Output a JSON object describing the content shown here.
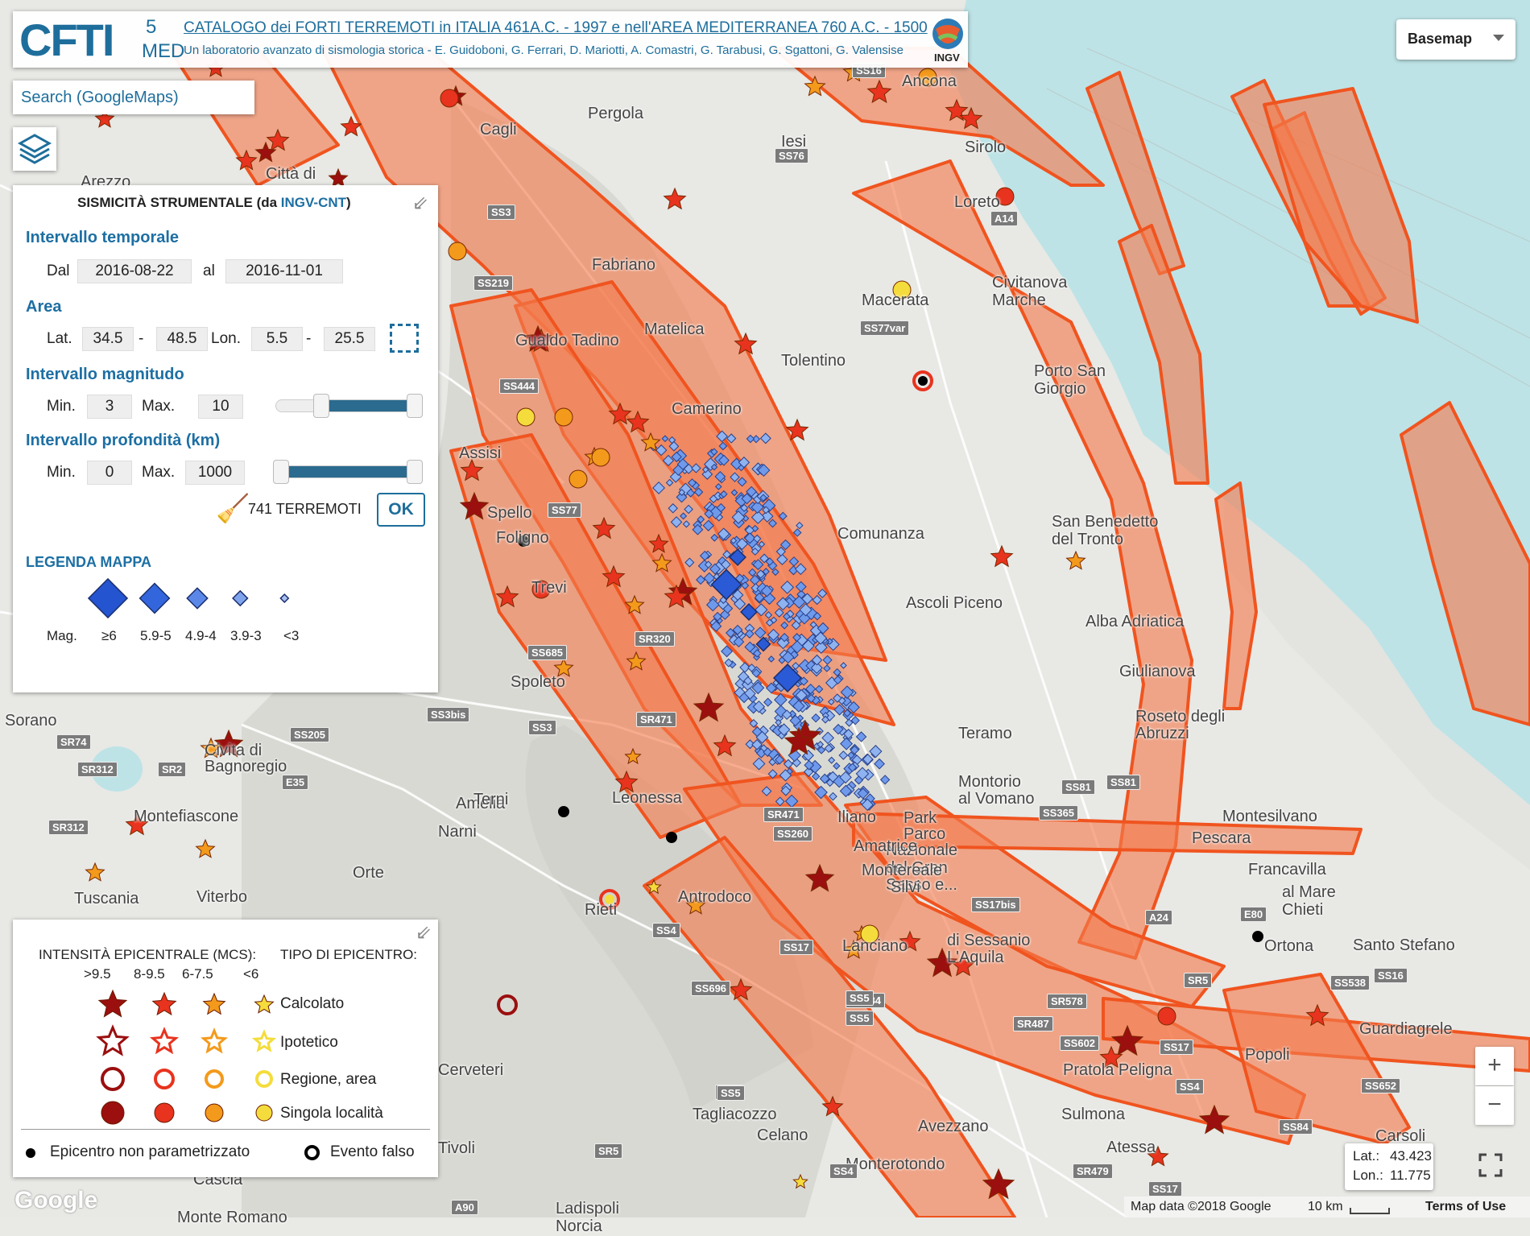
{
  "header": {
    "logo_main": "CFTI",
    "logo_super": "5",
    "logo_sub": "MED",
    "title": "CATALOGO dei FORTI TERREMOTI in ITALIA 461A.C. - 1997 e nell'AREA MEDITERRANEA 760 A.C. - 1500",
    "subtitle": "Un laboratorio avanzato di sismologia storica - E. Guidoboni, G. Ferrari, D. Mariotti, A. Comastri, G. Tarabusi, G. Sgattoni, G. Valensise",
    "ingv_label": "INGV"
  },
  "search": {
    "placeholder": "Search (GoogleMaps)"
  },
  "basemap": {
    "label": "Basemap"
  },
  "filter_panel": {
    "title_prefix": "SISMICITÀ STRUMENTALE (da ",
    "title_link": "INGV-CNT",
    "title_suffix": ")",
    "time_heading": "Intervallo temporale",
    "from_label": "Dal",
    "from_value": "2016-08-22",
    "to_label": "al",
    "to_value": "2016-11-01",
    "area_heading": "Area",
    "lat_label": "Lat.",
    "lat_min": "34.5",
    "lat_max": "48.5",
    "lon_label": "Lon.",
    "lon_min": "5.5",
    "lon_max": "25.5",
    "dash": "-",
    "mag_heading": "Intervallo magnitudo",
    "min_label": "Min.",
    "max_label": "Max.",
    "mag_min": "3",
    "mag_max": "10",
    "depth_heading": "Intervallo profondità (km)",
    "depth_min": "0",
    "depth_max": "1000",
    "count_text": "741 TERREMOTI",
    "ok_label": "OK",
    "legend_heading": "LEGENDA MAPPA",
    "legend_mag_label": "Mag.",
    "legend_classes": [
      "≥6",
      "5.9-5",
      "4.9-4",
      "3.9-3",
      "<3"
    ]
  },
  "legend_panel": {
    "intensity_heading": "INTENSITÀ EPICENTRALE (MCS):",
    "type_heading": "TIPO DI EPICENTRO:",
    "intensity_classes": [
      ">9.5",
      "8-9.5",
      "6-7.5",
      "<6"
    ],
    "class_colors": [
      "#9b0f0f",
      "#e8331e",
      "#f39a1c",
      "#f4dc3c"
    ],
    "rows": [
      "Calcolato",
      "Ipotetico",
      "Regione, area",
      "Singola località"
    ],
    "non_param": "Epicentro non parametrizzato",
    "false_event": "Evento falso"
  },
  "zoom": {
    "in": "+",
    "out": "−"
  },
  "coords": {
    "lat_label": "Lat.:",
    "lat": "43.423",
    "lon_label": "Lon.:",
    "lon": "11.775"
  },
  "footer": {
    "google": "Google",
    "map_data": "Map data ©2018 Google",
    "scale": "10 km",
    "terms": "Terms of Use"
  },
  "places": [
    "Arezzo",
    "Città di",
    "Cagli",
    "Pergola",
    "Iesi",
    "Ancona",
    "Sirolo",
    "Loreto",
    "Fabriano",
    "Matelica",
    "Gualdo Tadino",
    "Macerata",
    "Civitanova",
    "Marche",
    "Porto San",
    "Giorgio",
    "Tolentino",
    "Camerino",
    "Assisi",
    "Spello",
    "Foligno",
    "Trevi",
    "Spoleto",
    "Comunanza",
    "San Benedetto",
    "del Tronto",
    "Ascoli Piceno",
    "Alba Adriatica",
    "Giulianova",
    "Roseto degli",
    "Abruzzi",
    "Teramo",
    "Montorio",
    "al Vomano",
    "Sorano",
    "Civita di",
    "Bagnoregio",
    "Montefiascone",
    "Tuscania",
    "Viterbo",
    "Amelia",
    "Narni",
    "Terni",
    "Orte",
    "Leonessa",
    "Antrodoco",
    "Rieti",
    "Park",
    "Parco",
    "Nazionale",
    "del Gran",
    "Sasso e...",
    "Silvi",
    "Montesilvano",
    "Pescara",
    "Francavilla",
    "al Mare",
    "Chieti",
    "Ortona",
    "Santo Stefano",
    "di Sessanio",
    "L'Aquila",
    "Lanciano",
    "Guardiagrele",
    "Popoli",
    "Pratola Peligna",
    "Sulmona",
    "Atessa",
    "Carsoli",
    "Tagliacozzo",
    "Celano",
    "Avezzano",
    "Monterotondo",
    "Tivoli",
    "Ladispoli",
    "Monte Romano",
    "Cerveteri",
    "Cascia",
    "Norcia",
    "Amatrice",
    "Montereale",
    "Iliano"
  ],
  "roads": [
    "SS76",
    "SS3",
    "A14",
    "SS219",
    "SS77var",
    "SS444",
    "SS77",
    "SS685",
    "SR320",
    "SS4",
    "SR471",
    "SS3bis",
    "SS3",
    "SR74",
    "SS205",
    "SR312",
    "SR2",
    "E35",
    "SR312",
    "SS81",
    "SS365",
    "SR471",
    "SS260",
    "SS17bis",
    "SS17",
    "SS584",
    "SS5",
    "SS696",
    "SR578",
    "SS602",
    "SS17",
    "SR487",
    "SS5",
    "SR5",
    "SR5",
    "SS4",
    "A90",
    "SR479",
    "SS17",
    "SS16",
    "SS538",
    "SS652",
    "SS84",
    "E80",
    "SR5",
    "SS81",
    "SS4",
    "A24",
    "SS5",
    "SS16"
  ]
}
